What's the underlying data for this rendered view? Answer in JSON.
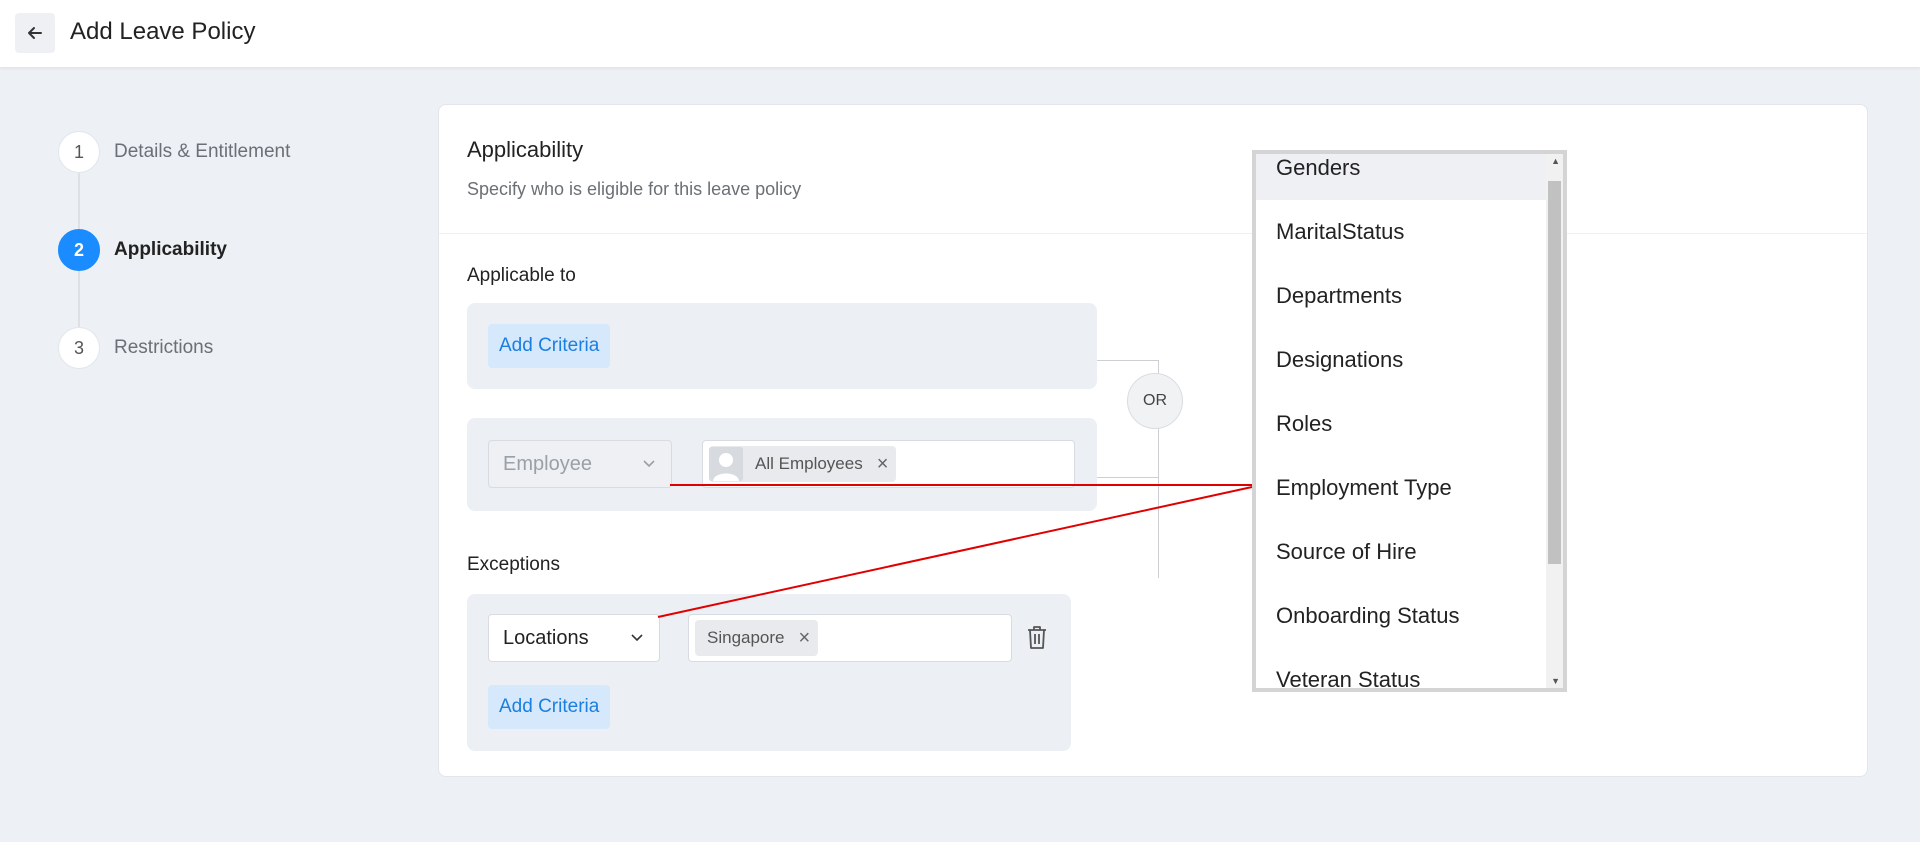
{
  "header": {
    "title": "Add Leave Policy",
    "back_icon": "arrow-left-icon"
  },
  "stepper": {
    "steps": [
      {
        "number": "1",
        "label": "Details & Entitlement",
        "active": false
      },
      {
        "number": "2",
        "label": "Applicability",
        "active": true
      },
      {
        "number": "3",
        "label": "Restrictions",
        "active": false
      }
    ]
  },
  "section": {
    "title": "Applicability",
    "subtitle": "Specify who is eligible for this leave policy"
  },
  "applicable_to": {
    "label": "Applicable to",
    "add_criteria_label": "Add Criteria",
    "or_label": "OR",
    "criteria": {
      "field": "Employee",
      "tag": "All Employees",
      "tag_remove": "×"
    }
  },
  "exceptions": {
    "label": "Exceptions",
    "criteria": {
      "field": "Locations",
      "tag": "Singapore",
      "tag_remove": "×"
    },
    "add_criteria_label": "Add Criteria"
  },
  "dropdown": {
    "items": [
      "Genders",
      "MaritalStatus",
      "Departments",
      "Designations",
      "Roles",
      "Employment Type",
      "Source of Hire",
      "Onboarding Status",
      "Veteran Status"
    ],
    "highlighted": "Genders"
  },
  "colors": {
    "accent": "#1a8cff",
    "link": "#1a7fe0",
    "annotation_line": "#e00000"
  }
}
